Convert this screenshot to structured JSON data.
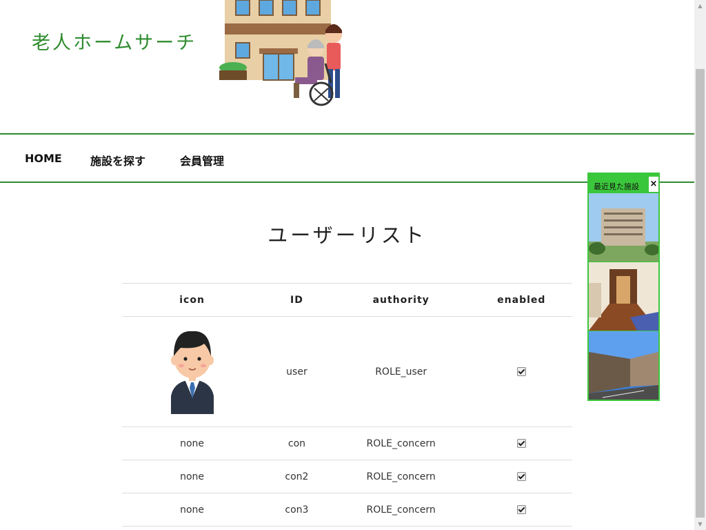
{
  "header": {
    "site_title": "老人ホームサーチ"
  },
  "nav": {
    "items": [
      {
        "label": "HOME"
      },
      {
        "label": "施設を探す"
      },
      {
        "label": "会員管理"
      }
    ]
  },
  "main": {
    "page_title": "ユーザーリスト",
    "table": {
      "columns": [
        "icon",
        "ID",
        "authority",
        "enabled"
      ],
      "rows": [
        {
          "icon": "",
          "id": "user",
          "authority": "ROLE_user",
          "enabled": true
        },
        {
          "icon": "none",
          "id": "con",
          "authority": "ROLE_concern",
          "enabled": true
        },
        {
          "icon": "none",
          "id": "con2",
          "authority": "ROLE_concern",
          "enabled": true
        },
        {
          "icon": "none",
          "id": "con3",
          "authority": "ROLE_concern",
          "enabled": true
        }
      ]
    }
  },
  "recent_panel": {
    "title": "最近見た施設",
    "close_label": "×"
  },
  "colors": {
    "accent": "#2e8b2e",
    "panel": "#3bc73b"
  }
}
